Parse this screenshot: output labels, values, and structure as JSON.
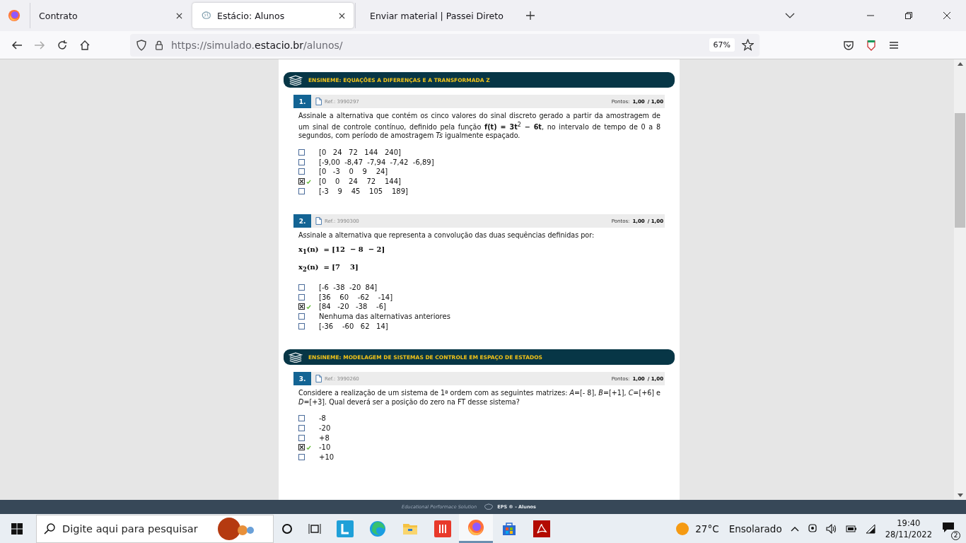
{
  "browser": {
    "tabs": [
      {
        "title": "Contrato",
        "selected": false
      },
      {
        "title": "Estácio: Alunos",
        "selected": true
      },
      {
        "title": "Enviar material | Passei Direto",
        "selected": false
      }
    ],
    "url_prefix": "https://simulado.",
    "url_domain": "estacio.br",
    "url_suffix": "/alunos/",
    "zoom": "67%"
  },
  "sections": [
    {
      "title": "ENSINEME: EQUAÇÕES A DIFERENÇAS E A TRANSFORMADA Z",
      "questions": [
        {
          "number": "1.",
          "ref": "Ref.: 3990297",
          "points_label": "Pontos:",
          "score": "1,00",
          "total": "/ 1,00",
          "statement": "Assinale a alternativa que contém os cinco valores do sinal discreto gerado a partir da amostragem de um sinal de controle contínuo, definido pela função **f(t) = 3t**$^{2}$ **− 6t**, no intervalo de tempo de 0 a 8 segundos, com período de amostragem *Ts* igualmente espaçado.",
          "options": [
            {
              "text": "[0   24   72   144   240]",
              "checked": false,
              "correct": false
            },
            {
              "text": "[-9,00  -8,47  -7,94  -7,42  -6,89]",
              "checked": false,
              "correct": false
            },
            {
              "text": "[0   -3    0    9    24]",
              "checked": false,
              "correct": false
            },
            {
              "text": "[0    0    24    72    144]",
              "checked": true,
              "correct": true
            },
            {
              "text": "[-3    9    45    105    189]",
              "checked": false,
              "correct": false
            }
          ]
        },
        {
          "number": "2.",
          "ref": "Ref.: 3990300",
          "points_label": "Pontos:",
          "score": "1,00",
          "total": "/ 1,00",
          "statement": "Assinale a alternativa que representa a convolução das duas sequências definidas por:",
          "formulas": [
            "x$_{1}$(n)  = [12  − 8  − 2]",
            "x$_{2}$(n)  = [7    3]"
          ],
          "options": [
            {
              "text": "[-6  -38  -20  84]",
              "checked": false,
              "correct": false
            },
            {
              "text": "[36    60    -62    -14]",
              "checked": false,
              "correct": false
            },
            {
              "text": "[84   -20   -38    -6]",
              "checked": true,
              "correct": true
            },
            {
              "text": "Nenhuma das alternativas anteriores",
              "checked": false,
              "correct": false
            },
            {
              "text": "[-36    -60   62   14]",
              "checked": false,
              "correct": false
            }
          ]
        }
      ]
    },
    {
      "title": "ENSINEME: MODELAGEM DE SISTEMAS DE CONTROLE EM ESPAÇO DE ESTADOS",
      "questions": [
        {
          "number": "3.",
          "ref": "Ref.: 3990260",
          "points_label": "Pontos:",
          "score": "1,00",
          "total": "/ 1,00",
          "statement": "Considere a realização de um sistema de 1ª ordem com as seguintes matrizes: *A*=[- 8], *B*=[+1], *C*=[+6] e *D*=[+3]. Qual deverá ser a posição do zero na FT desse sistema?",
          "options": [
            {
              "text": "-8",
              "checked": false,
              "correct": false
            },
            {
              "text": "-20",
              "checked": false,
              "correct": false
            },
            {
              "text": "+8",
              "checked": false,
              "correct": false
            },
            {
              "text": "-10",
              "checked": true,
              "correct": true
            },
            {
              "text": "+10",
              "checked": false,
              "correct": false
            }
          ]
        }
      ]
    }
  ],
  "footer": {
    "tagline": "Educational Performace Solution",
    "brand": "EPS ® - Alunos"
  },
  "taskbar": {
    "search_placeholder": "Digite aqui para pesquisar",
    "temperature": "27°C",
    "weather": "Ensolarado",
    "time": "19:40",
    "date": "28/11/2022",
    "notifications": "2"
  }
}
